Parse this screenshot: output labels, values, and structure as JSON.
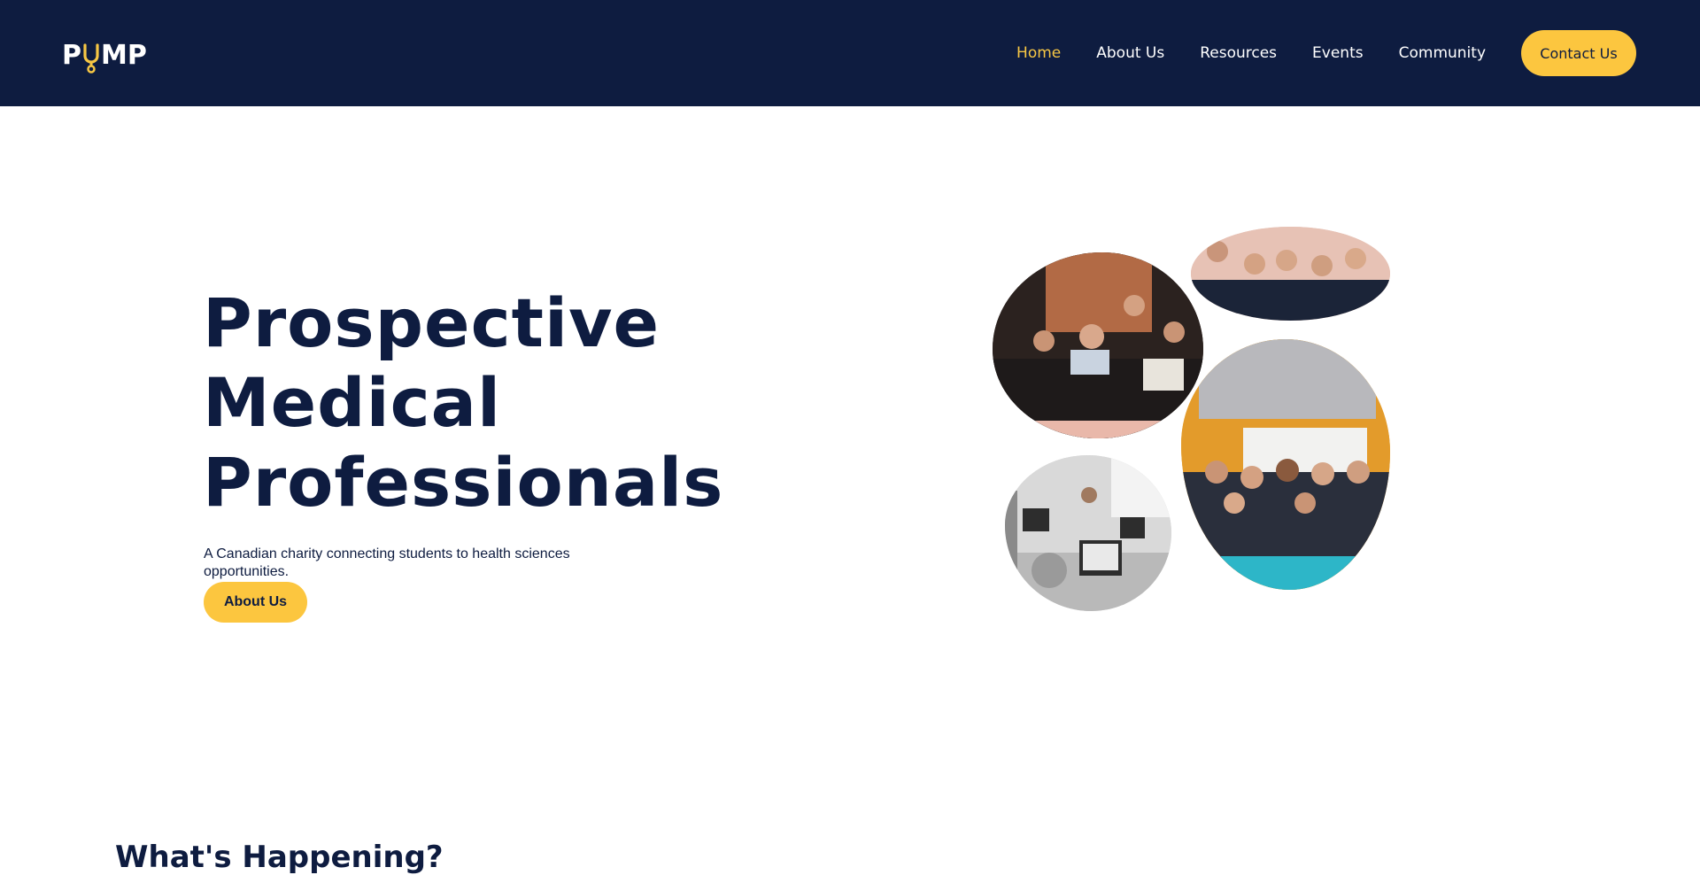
{
  "brand": {
    "logo_text_left": "P",
    "logo_text_right": "MP",
    "accent_color": "#f7c744",
    "navy_color": "#0e1c40"
  },
  "nav": {
    "items": [
      {
        "label": "Home",
        "active": true
      },
      {
        "label": "About Us",
        "active": false
      },
      {
        "label": "Resources",
        "active": false
      },
      {
        "label": "Events",
        "active": false
      },
      {
        "label": "Community",
        "active": false
      }
    ],
    "contact_label": "Contact Us"
  },
  "hero": {
    "title_lines": [
      "Prospective",
      "Medical",
      "Professionals"
    ],
    "subtitle": "A Canadian charity connecting students to health sciences opportunities.",
    "cta_label": "About Us"
  },
  "section": {
    "heading": "What's Happening?"
  }
}
